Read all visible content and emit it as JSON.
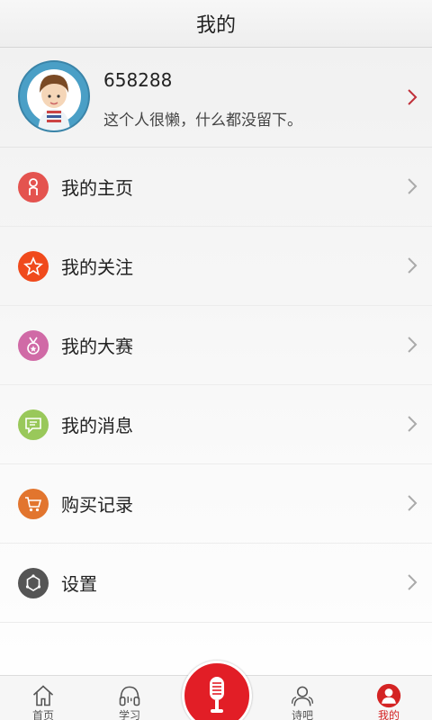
{
  "header": {
    "title": "我的"
  },
  "profile": {
    "username": "658288",
    "bio": "这个人很懒，什么都没留下。"
  },
  "menu": [
    {
      "label": "我的主页",
      "icon": "person-icon",
      "color": "#e4534f"
    },
    {
      "label": "我的关注",
      "icon": "star-icon",
      "color": "#f04a1c"
    },
    {
      "label": "我的大赛",
      "icon": "medal-icon",
      "color": "#d06aa6"
    },
    {
      "label": "我的消息",
      "icon": "message-icon",
      "color": "#99c85a"
    },
    {
      "label": "购买记录",
      "icon": "cart-icon",
      "color": "#e2752e"
    },
    {
      "label": "设置",
      "icon": "settings-icon",
      "color": "#555555"
    }
  ],
  "tabs": [
    {
      "label": "首页",
      "icon": "home-icon"
    },
    {
      "label": "学习",
      "icon": "headphones-icon"
    },
    {
      "label": "",
      "icon": "microphone-icon"
    },
    {
      "label": "诗吧",
      "icon": "people-icon"
    },
    {
      "label": "我的",
      "icon": "user-icon",
      "active": true
    }
  ],
  "colors": {
    "accent": "#e21e26",
    "active_tab": "#d42323"
  }
}
